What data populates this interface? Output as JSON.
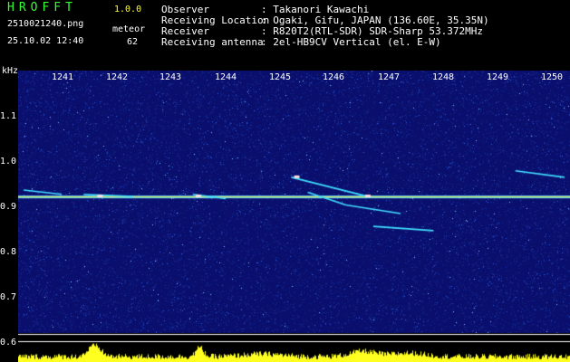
{
  "header": {
    "app_title": "HROFFT",
    "app_version": "1.0.0",
    "file_name": "2510021240.png",
    "datetime": "25.10.02 12:40",
    "meteor_label": "meteor",
    "meteor_count": "62"
  },
  "info": [
    {
      "key": "Observer",
      "value": ": Takanori Kawachi"
    },
    {
      "key": "Receiving Location",
      "value": ": Ogaki, Gifu, JAPAN (136.60E, 35.35N)"
    },
    {
      "key": "Receiver",
      "value": ": R820T2(RTL-SDR) SDR-Sharp 53.372MHz"
    },
    {
      "key": "Receiving antenna",
      "value": ": 2el-HB9CV Vertical (el. E-W)"
    }
  ],
  "colors": {
    "background": "#0a0f6e",
    "noise": "#3050d0",
    "carrier": "#e8e040",
    "echo": "#40e0ff",
    "power_trace": "#ffff20",
    "title": "#33ff33",
    "version": "#ffff33"
  },
  "chart_data": {
    "type": "heatmap",
    "ylabel": "kHz",
    "yticks": [
      "1.1",
      "1.0",
      "0.9",
      "0.8",
      "0.7",
      "0.6"
    ],
    "xticks": [
      "1241",
      "1242",
      "1243",
      "1244",
      "1245",
      "1246",
      "1247",
      "1248",
      "1249",
      "1250"
    ],
    "xlim": [
      1240.2,
      1250.3
    ],
    "ylim": [
      0.58,
      1.195
    ],
    "carrier_khz": 0.9,
    "echoes": [
      {
        "x": [
          1240.3,
          1241.0
        ],
        "y": [
          0.915,
          0.905
        ]
      },
      {
        "x": [
          1245.2,
          1246.6
        ],
        "y": [
          0.945,
          0.9
        ]
      },
      {
        "x": [
          1245.5,
          1246.2
        ],
        "y": [
          0.91,
          0.88
        ]
      },
      {
        "x": [
          1246.2,
          1247.2
        ],
        "y": [
          0.88,
          0.86
        ]
      },
      {
        "x": [
          1246.7,
          1247.8
        ],
        "y": [
          0.83,
          0.82
        ]
      },
      {
        "x": [
          1249.3,
          1250.2
        ],
        "y": [
          0.96,
          0.945
        ]
      },
      {
        "x": [
          1241.4,
          1242.3
        ],
        "y": [
          0.905,
          0.9
        ]
      },
      {
        "x": [
          1243.4,
          1244.0
        ],
        "y": [
          0.905,
          0.895
        ]
      }
    ]
  }
}
